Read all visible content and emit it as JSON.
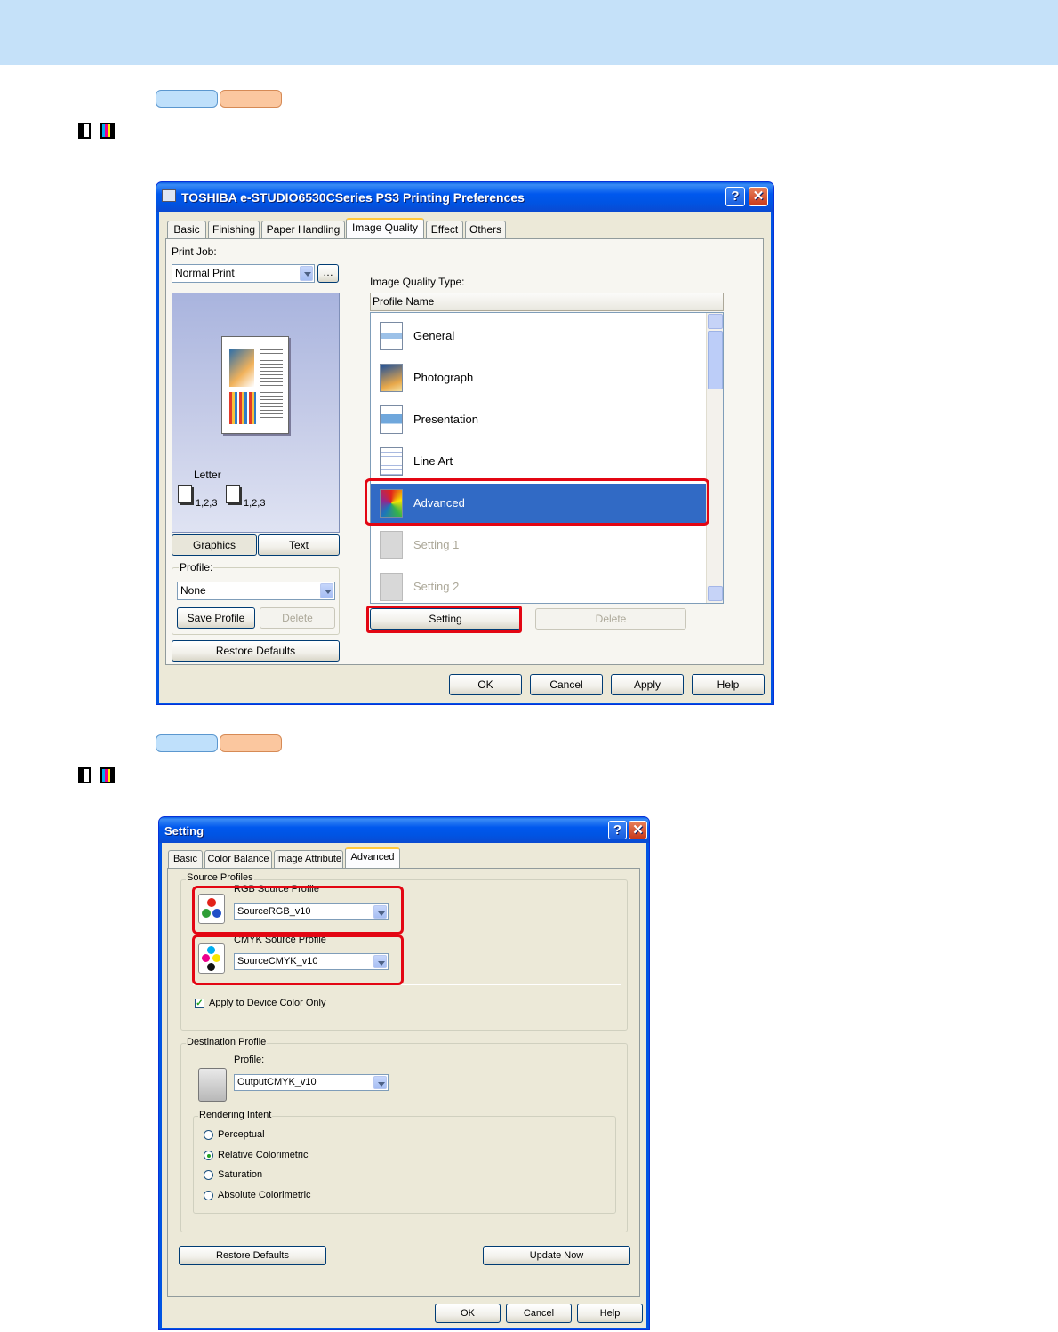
{
  "window1": {
    "title": "TOSHIBA e-STUDIO6530CSeries PS3 Printing Preferences",
    "tabs": [
      "Basic",
      "Finishing",
      "Paper Handling",
      "Image Quality",
      "Effect",
      "Others"
    ],
    "print_job_label": "Print Job:",
    "print_job_value": "Normal Print",
    "paper_label": "Letter",
    "copies_a": "1,2,3",
    "copies_b": "1,2,3",
    "view_tabs": [
      "Graphics",
      "Text"
    ],
    "profile_label": "Profile:",
    "profile_value": "None",
    "save_profile": "Save Profile",
    "delete": "Delete",
    "restore_defaults": "Restore Defaults",
    "iq_type_label": "Image Quality Type:",
    "list_header": "Profile Name",
    "list_items": [
      "General",
      "Photograph",
      "Presentation",
      "Line Art",
      "Advanced",
      "Setting 1",
      "Setting 2"
    ],
    "setting_button": "Setting",
    "delete_button": "Delete",
    "ok": "OK",
    "cancel": "Cancel",
    "apply": "Apply",
    "help": "Help"
  },
  "window2": {
    "title": "Setting",
    "tabs": [
      "Basic",
      "Color Balance",
      "Image Attribute",
      "Advanced"
    ],
    "source_profiles_label": "Source Profiles",
    "rgb_label": "RGB Source Profile",
    "rgb_value": "SourceRGB_v10",
    "cmyk_label": "CMYK Source Profile",
    "cmyk_value": "SourceCMYK_v10",
    "apply_device_label": "Apply to Device Color Only",
    "destination_label": "Destination Profile",
    "dest_profile_label": "Profile:",
    "dest_profile_value": "OutputCMYK_v10",
    "rendering_label": "Rendering Intent",
    "rendering_options": [
      "Perceptual",
      "Relative Colorimetric",
      "Saturation",
      "Absolute Colorimetric"
    ],
    "restore_defaults": "Restore Defaults",
    "update_now": "Update Now",
    "ok": "OK",
    "cancel": "Cancel",
    "help": "Help"
  },
  "help_glyph": "?",
  "close_glyph": "✕"
}
